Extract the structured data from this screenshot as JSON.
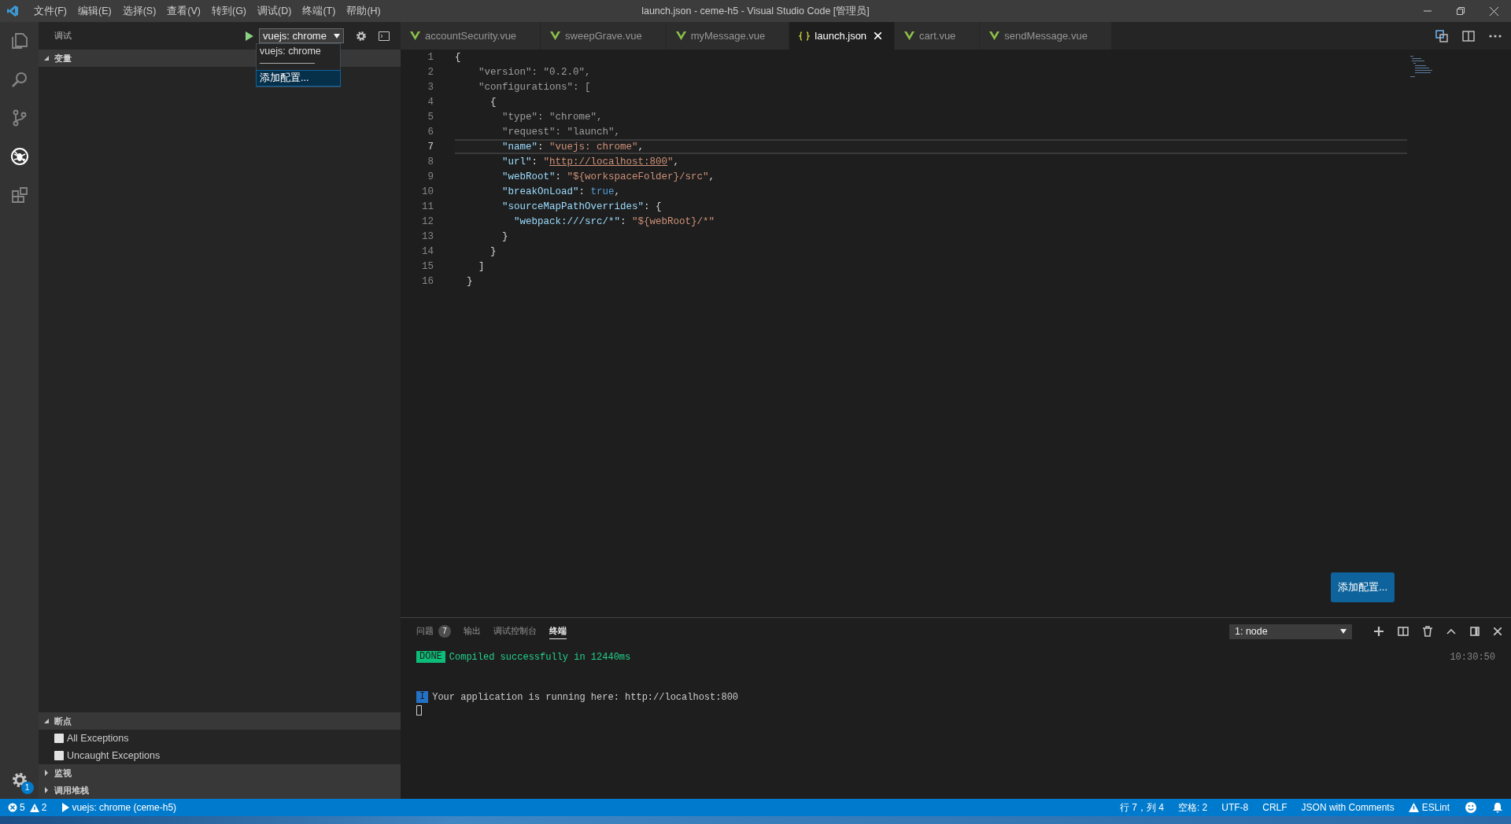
{
  "window": {
    "title": "launch.json - ceme-h5 - Visual Studio Code [管理员]"
  },
  "menu": [
    "文件(F)",
    "编辑(E)",
    "选择(S)",
    "查看(V)",
    "转到(G)",
    "调试(D)",
    "终端(T)",
    "帮助(H)"
  ],
  "activity_bar": {
    "items": [
      {
        "kind": "files",
        "selected": false
      },
      {
        "kind": "search",
        "selected": false
      },
      {
        "kind": "scm",
        "selected": false
      },
      {
        "kind": "debug",
        "selected": true
      },
      {
        "kind": "extensions",
        "selected": false
      }
    ],
    "settings_badge": "1"
  },
  "sidebar": {
    "title": "调试",
    "configuration": "vuejs: chrome",
    "dropdown": {
      "options": [
        {
          "label": "vuejs: chrome",
          "selected": false
        },
        {
          "label": "添加配置...",
          "selected": true
        }
      ]
    },
    "sections": [
      {
        "title": "变量",
        "expanded": true
      },
      {
        "title": "断点",
        "expanded": true,
        "items": [
          {
            "label": "All Exceptions",
            "checked": false
          },
          {
            "label": "Uncaught Exceptions",
            "checked": false
          }
        ]
      },
      {
        "title": "监视",
        "expanded": false
      },
      {
        "title": "调用堆栈",
        "expanded": false
      }
    ]
  },
  "tabs": [
    {
      "label": "accountSecurity.vue",
      "kind": "vue",
      "selected": false
    },
    {
      "label": "sweepGrave.vue",
      "kind": "vue",
      "selected": false
    },
    {
      "label": "myMessage.vue",
      "kind": "vue",
      "selected": false
    },
    {
      "label": "launch.json",
      "kind": "json",
      "selected": true
    },
    {
      "label": "cart.vue",
      "kind": "vue",
      "selected": false
    },
    {
      "label": "sendMessage.vue",
      "kind": "vue",
      "selected": false
    }
  ],
  "editor": {
    "lines": [
      {
        "number": "1",
        "current": false,
        "tokens": [
          {
            "kind": "punct",
            "text": "{"
          }
        ]
      },
      {
        "number": "2",
        "current": false,
        "tokens": [
          {
            "kind": "dim",
            "text": "    \"version\": \"0.2.0\","
          }
        ]
      },
      {
        "number": "3",
        "current": false,
        "tokens": [
          {
            "kind": "dim",
            "text": "    \"configurations\": ["
          }
        ]
      },
      {
        "number": "4",
        "current": false,
        "tokens": [
          {
            "kind": "punct",
            "text": "      {"
          }
        ]
      },
      {
        "number": "5",
        "current": false,
        "tokens": [
          {
            "kind": "dim",
            "text": "        \"type\": \"chrome\","
          }
        ]
      },
      {
        "number": "6",
        "current": false,
        "tokens": [
          {
            "kind": "dim",
            "text": "        \"request\": \"launch\","
          }
        ]
      },
      {
        "number": "7",
        "current": true,
        "tokens": [
          {
            "kind": "key",
            "text": "        \"name\""
          },
          {
            "kind": "punct",
            "text": ": "
          },
          {
            "kind": "string",
            "text": "\"vuejs: chrome\""
          },
          {
            "kind": "punct",
            "text": ","
          }
        ]
      },
      {
        "number": "8",
        "current": false,
        "tokens": [
          {
            "kind": "key",
            "text": "        \"url\""
          },
          {
            "kind": "punct",
            "text": ": "
          },
          {
            "kind": "string",
            "text": "\""
          },
          {
            "kind": "link",
            "text": "http://localhost:800"
          },
          {
            "kind": "string",
            "text": "\""
          },
          {
            "kind": "punct",
            "text": ","
          }
        ]
      },
      {
        "number": "9",
        "current": false,
        "tokens": [
          {
            "kind": "key",
            "text": "        \"webRoot\""
          },
          {
            "kind": "punct",
            "text": ": "
          },
          {
            "kind": "string",
            "text": "\"${workspaceFolder}/src\""
          },
          {
            "kind": "punct",
            "text": ","
          }
        ]
      },
      {
        "number": "10",
        "current": false,
        "tokens": [
          {
            "kind": "key",
            "text": "        \"breakOnLoad\""
          },
          {
            "kind": "punct",
            "text": ": "
          },
          {
            "kind": "bool",
            "text": "true"
          },
          {
            "kind": "punct",
            "text": ","
          }
        ]
      },
      {
        "number": "11",
        "current": false,
        "tokens": [
          {
            "kind": "key",
            "text": "        \"sourceMapPathOverrides\""
          },
          {
            "kind": "punct",
            "text": ": {"
          }
        ]
      },
      {
        "number": "12",
        "current": false,
        "tokens": [
          {
            "kind": "key",
            "text": "          \"webpack:///src/*\""
          },
          {
            "kind": "punct",
            "text": ": "
          },
          {
            "kind": "string",
            "text": "\"${webRoot}/*\""
          }
        ]
      },
      {
        "number": "13",
        "current": false,
        "tokens": [
          {
            "kind": "punct",
            "text": "        }"
          }
        ]
      },
      {
        "number": "14",
        "current": false,
        "tokens": [
          {
            "kind": "punct",
            "text": "      }"
          }
        ]
      },
      {
        "number": "15",
        "current": false,
        "tokens": [
          {
            "kind": "punct",
            "text": "    ]"
          }
        ]
      },
      {
        "number": "16",
        "current": false,
        "tokens": [
          {
            "kind": "punct",
            "text": "  }"
          }
        ]
      }
    ],
    "floating_button": "添加配置..."
  },
  "panel": {
    "tabs": [
      {
        "label": "问题",
        "badge": "7",
        "selected": false
      },
      {
        "label": "输出",
        "selected": false
      },
      {
        "label": "调试控制台",
        "selected": false
      },
      {
        "label": "终端",
        "selected": true
      }
    ],
    "terminal_select": "1: node",
    "lines": [
      {
        "kind": "done",
        "badge": "DONE",
        "text": "Compiled successfully in 12440ms",
        "time": "10:30:50"
      },
      {
        "kind": "info",
        "badge": "I",
        "text": "Your application is running here: http://localhost:800"
      }
    ]
  },
  "status_bar": {
    "errors": "5",
    "warnings": "2",
    "debug_target": "vuejs: chrome (ceme-h5)",
    "items": [
      {
        "kind": "text",
        "text": "行 7，列 4"
      },
      {
        "kind": "text",
        "text": "空格: 2"
      },
      {
        "kind": "text",
        "text": "UTF-8"
      },
      {
        "kind": "text",
        "text": "CRLF"
      },
      {
        "kind": "text",
        "text": "JSON with Comments"
      },
      {
        "kind": "eslint",
        "text": "ESLint"
      },
      {
        "kind": "feedback"
      },
      {
        "kind": "notifications"
      }
    ]
  }
}
